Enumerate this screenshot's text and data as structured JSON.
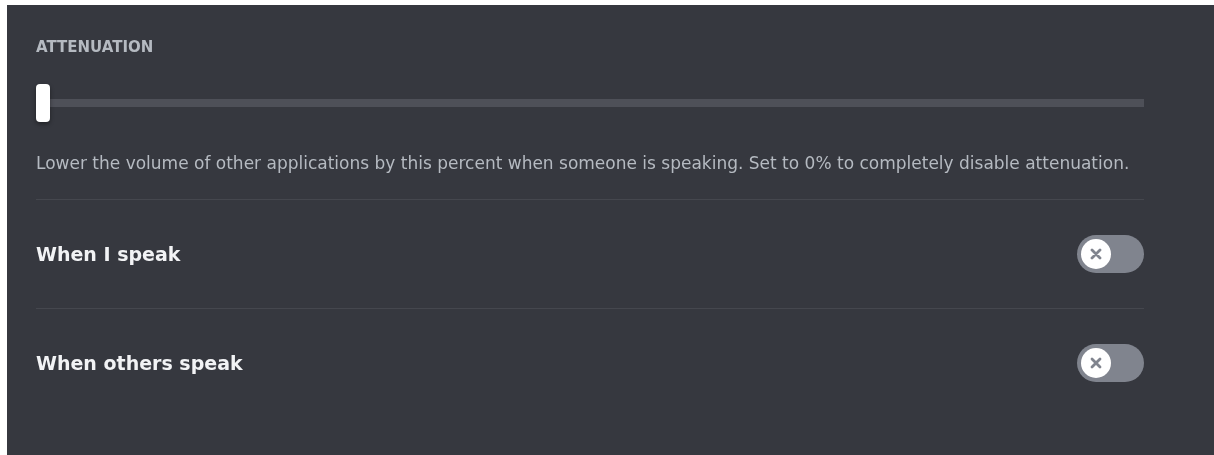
{
  "heading": "ATTENUATION",
  "slider": {
    "level": 0
  },
  "description": "Lower the volume of other applications by this percent when someone is speaking. Set to 0% to completely disable attenuation.",
  "toggles": [
    {
      "label": "When I speak",
      "on": false
    },
    {
      "label": "When others speak",
      "on": false
    }
  ]
}
